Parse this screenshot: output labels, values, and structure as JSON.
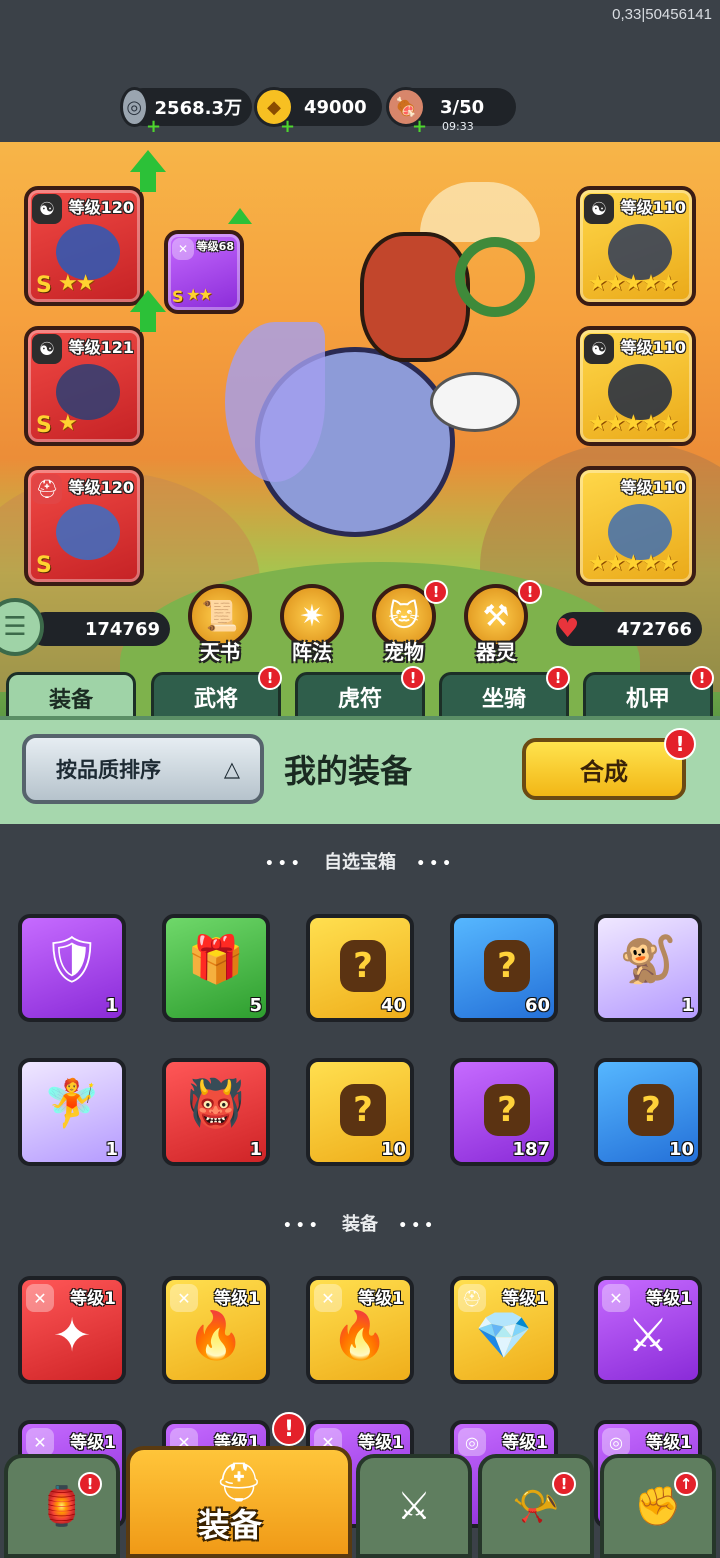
{
  "status": {
    "build_id": "0,33|50456141"
  },
  "resources": {
    "silver": {
      "icon": "silver-coin-icon",
      "value": "2568.3万"
    },
    "gold": {
      "icon": "gold-ingot-icon",
      "value": "49000"
    },
    "stamina": {
      "icon": "meat-icon",
      "value": "3/50",
      "timer": "09:33"
    },
    "plus": "+"
  },
  "hero": {
    "left_slots": [
      {
        "level": "等级120",
        "grade": "S",
        "stars": "★★"
      },
      {
        "level": "等级121",
        "grade": "S",
        "stars": "★"
      },
      {
        "level": "等级120",
        "grade": "S",
        "stars": ""
      }
    ],
    "extra_slot": {
      "level": "等级68",
      "grade": "S",
      "stars": "★★"
    },
    "right_slots": [
      {
        "level": "等级110",
        "stars": "★★★★★"
      },
      {
        "level": "等级110",
        "stars": "★★★★★"
      },
      {
        "level": "等级110",
        "stars": "★★★★★"
      }
    ],
    "power": "174769",
    "hp": "472766",
    "features": [
      {
        "label": "天书",
        "icon": "scroll-icon"
      },
      {
        "label": "阵法",
        "icon": "formation-icon"
      },
      {
        "label": "宠物",
        "icon": "pet-icon"
      },
      {
        "label": "器灵",
        "icon": "spirit-icon"
      }
    ],
    "badge": "!"
  },
  "tabs": [
    "装备",
    "武将",
    "虎符",
    "坐骑",
    "机甲"
  ],
  "panel": {
    "sort_label": "按品质排序",
    "sort_caret": "△",
    "title": "我的装备",
    "merge_label": "合成"
  },
  "sections": {
    "chests": "自选宝箱",
    "equipment": "装备",
    "dots": "•••"
  },
  "chests_row1": [
    {
      "count": "1",
      "color": "purple"
    },
    {
      "count": "5",
      "color": "green"
    },
    {
      "count": "40",
      "color": "gold"
    },
    {
      "count": "60",
      "color": "blue"
    },
    {
      "count": "1",
      "color": "lav"
    }
  ],
  "chests_row2": [
    {
      "count": "1",
      "color": "lav"
    },
    {
      "count": "1",
      "color": "red"
    },
    {
      "count": "10",
      "color": "gold"
    },
    {
      "count": "187",
      "color": "purple"
    },
    {
      "count": "10",
      "color": "blue"
    }
  ],
  "equipment_row1": [
    {
      "level": "等级1",
      "color": "red"
    },
    {
      "level": "等级1",
      "color": "gold"
    },
    {
      "level": "等级1",
      "color": "gold"
    },
    {
      "level": "等级1",
      "color": "gold"
    },
    {
      "level": "等级1",
      "color": "purple"
    }
  ],
  "equipment_row2": [
    {
      "level": "等级1",
      "color": "purple"
    },
    {
      "level": "等级1",
      "color": "purple"
    },
    {
      "level": "等级1",
      "color": "purple"
    },
    {
      "level": "等级1",
      "color": "purple"
    },
    {
      "level": "等级1",
      "color": "purple"
    }
  ],
  "bottom_nav": {
    "equip_label": "装备"
  }
}
